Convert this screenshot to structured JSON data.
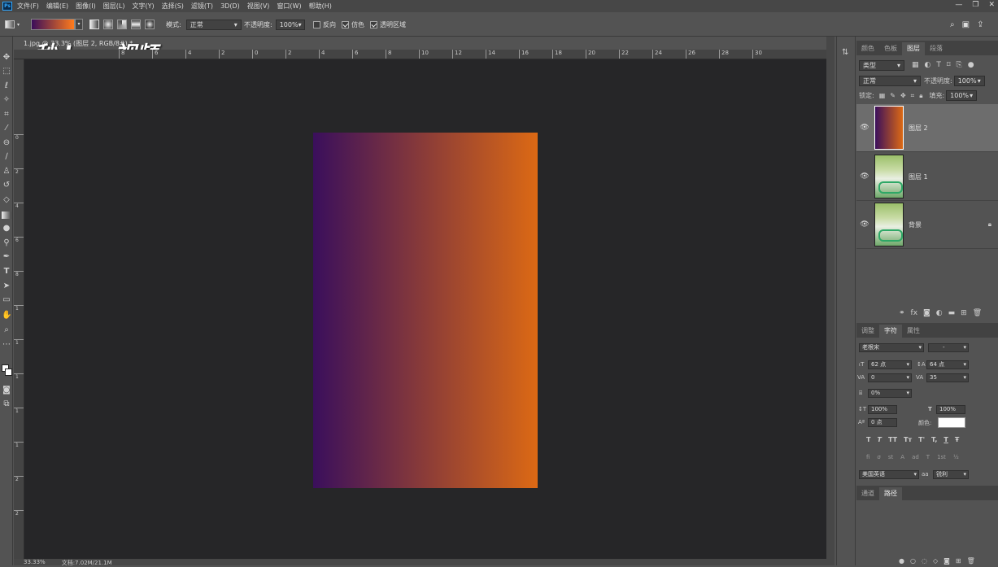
{
  "menu": {
    "app_badge": "Ps",
    "items": [
      "文件(F)",
      "编辑(E)",
      "图像(I)",
      "图层(L)",
      "文字(Y)",
      "选择(S)",
      "滤镜(T)",
      "3D(D)",
      "视图(V)",
      "窗口(W)",
      "帮助(H)"
    ],
    "window_controls": [
      "—",
      "❐",
      "✕"
    ]
  },
  "options": {
    "mode_label": "模式:",
    "mode_value": "正常",
    "opacity_label": "不透明度:",
    "opacity_value": "100%",
    "reverse_label": "反向",
    "dither_label": "仿色",
    "transparency_label": "透明区域",
    "reverse_checked": false,
    "dither_checked": true,
    "transparency_checked": true,
    "gradient_start": "#3a0d5a",
    "gradient_end": "#ff7b1c"
  },
  "document": {
    "tab_label": "1.jpg @ 33.3% (图层 2, RGB/8#) *",
    "watermark": "秒dong视频",
    "status_zoom": "33.33%",
    "status_doc": "文档:7.02M/21.1M"
  },
  "ruler": {
    "h_labels": [
      "8",
      "6",
      "4",
      "2",
      "0",
      "2",
      "4",
      "6",
      "8",
      "10",
      "12",
      "14",
      "16",
      "18",
      "20",
      "22",
      "24",
      "26",
      "28",
      "30"
    ],
    "v_labels": [
      "0",
      "2",
      "4",
      "6",
      "8",
      "1",
      "1",
      "1",
      "1",
      "1",
      "2",
      "2"
    ]
  },
  "canvas": {
    "gradient_start": "#3a0f5c",
    "gradient_end": "#dc6914"
  },
  "panels": {
    "top_tabs": [
      "颜色",
      "色板",
      "图层",
      "段落"
    ],
    "top_active": 2,
    "filter_kind": "类型",
    "blend_mode": "正常",
    "opacity_label": "不透明度:",
    "opacity_value": "100%",
    "lock_label": "锁定:",
    "fill_label": "填充:",
    "fill_value": "100%",
    "layers": [
      {
        "name": "图层 2",
        "selected": true,
        "type": "gradient"
      },
      {
        "name": "图层 1",
        "selected": false,
        "type": "photo"
      },
      {
        "name": "背景",
        "selected": false,
        "type": "photo",
        "locked": true
      }
    ],
    "layer_footer_icons": [
      "link-icon",
      "fx-icon",
      "mask-icon",
      "adjustment-icon",
      "folder-icon",
      "new-layer-icon",
      "trash-icon"
    ],
    "char_tabs": [
      "调整",
      "字符",
      "属性"
    ],
    "char_active": 1,
    "font_family": "老根宋",
    "font_style": "-",
    "font_size": "62 点",
    "leading": "64 点",
    "kerning": "0",
    "tracking": "35",
    "scale_pct": "0%",
    "vert_scale": "100%",
    "horiz_scale": "100%",
    "baseline": "0 点",
    "color_label": "颜色:",
    "text_style_buttons": [
      "T",
      "T",
      "TT",
      "Tт",
      "T'",
      "T,",
      "T",
      "Ŧ"
    ],
    "opentype_buttons": [
      "fi",
      "σ",
      "st",
      "A",
      "ad",
      "T",
      "1st",
      "½"
    ],
    "language": "美国英语",
    "aa_prefix": "aa",
    "antialias": "锐利",
    "bottom_tabs": [
      "通道",
      "路径"
    ],
    "bottom_active": 1
  }
}
